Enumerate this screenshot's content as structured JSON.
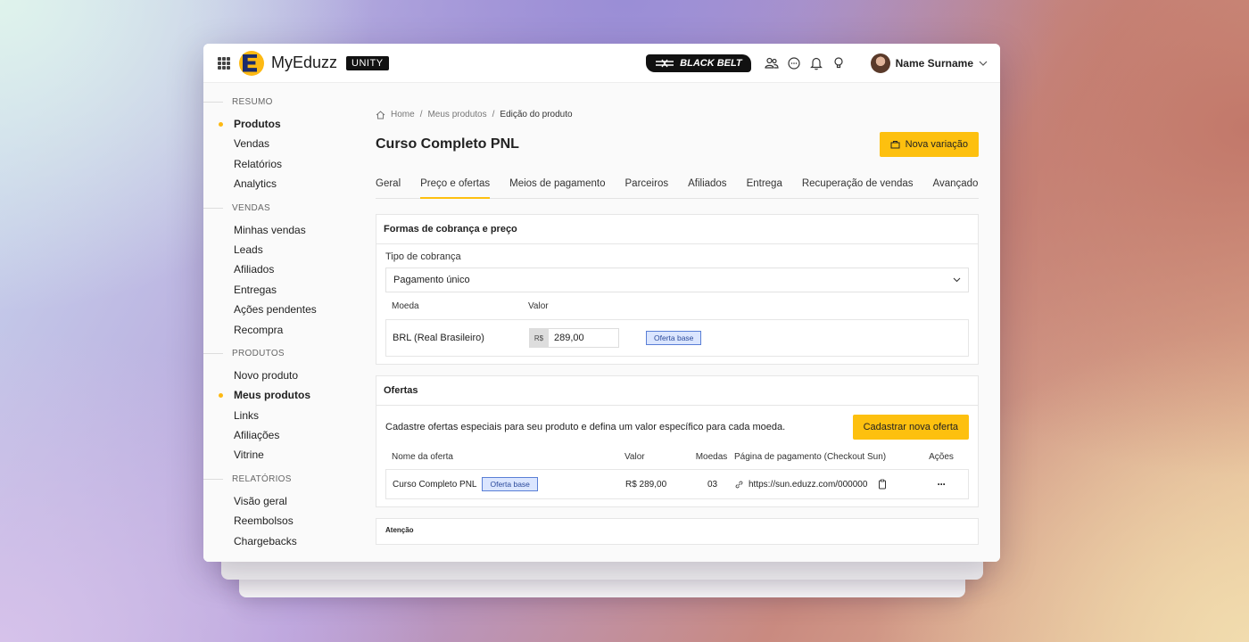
{
  "app": {
    "brand": "MyEduzz",
    "badge": "UNITY",
    "blackbelt": "BLACK BELT",
    "user_name": "Name Surname"
  },
  "icons": {
    "apps": "grid-icon",
    "users": "users-icon",
    "chat": "chat-icon",
    "notifications": "bell-icon",
    "tips": "lightbulb-icon"
  },
  "colors": {
    "accent": "#fdc00f",
    "badge_bg": "#dbe6ff",
    "badge_border": "#5a7fd6"
  },
  "sidebar": {
    "sections": [
      {
        "title": "RESUMO",
        "items": [
          {
            "label": "Produtos",
            "active": true
          },
          {
            "label": "Vendas"
          },
          {
            "label": "Relatórios"
          },
          {
            "label": "Analytics"
          }
        ]
      },
      {
        "title": "VENDAS",
        "items": [
          {
            "label": "Minhas vendas"
          },
          {
            "label": "Leads"
          },
          {
            "label": "Afiliados"
          },
          {
            "label": "Entregas"
          },
          {
            "label": "Ações pendentes"
          },
          {
            "label": "Recompra"
          }
        ]
      },
      {
        "title": "PRODUTOS",
        "items": [
          {
            "label": "Novo produto"
          },
          {
            "label": "Meus produtos",
            "active": true
          },
          {
            "label": "Links"
          },
          {
            "label": "Afiliações"
          },
          {
            "label": "Vitrine"
          }
        ]
      },
      {
        "title": "RELATÓRIOS",
        "items": [
          {
            "label": "Visão geral"
          },
          {
            "label": "Reembolsos"
          },
          {
            "label": "Chargebacks"
          }
        ]
      }
    ]
  },
  "breadcrumb": {
    "home": "Home",
    "sep": "/",
    "products": "Meus produtos",
    "current": "Edição do produto"
  },
  "page": {
    "title": "Curso Completo PNL",
    "new_variation": "Nova variação"
  },
  "tabs": [
    "Geral",
    "Preço e ofertas",
    "Meios de pagamento",
    "Parceiros",
    "Afiliados",
    "Entrega",
    "Recuperação de vendas",
    "Avançado"
  ],
  "active_tab": 1,
  "pricing": {
    "title": "Formas de cobrança e preço",
    "billing_label": "Tipo de cobrança",
    "billing_value": "Pagamento único",
    "col_currency": "Moeda",
    "col_value": "Valor",
    "currency": "BRL (Real Brasileiro)",
    "currency_prefix": "R$",
    "price": "289,00",
    "base_badge": "Oferta base"
  },
  "offers": {
    "title": "Ofertas",
    "description": "Cadastre ofertas especiais para seu produto e defina um valor específico para cada moeda.",
    "new_offer_button": "Cadastrar nova oferta",
    "headers": {
      "name": "Nome da oferta",
      "value": "Valor",
      "currencies": "Moedas",
      "page": "Página de pagamento (Checkout Sun)",
      "actions": "Ações"
    },
    "rows": [
      {
        "name": "Curso Completo PNL",
        "badge": "Oferta base",
        "value": "R$ 289,00",
        "currencies": "03",
        "url": "https://sun.eduzz.com/000000",
        "actions": "···"
      }
    ]
  },
  "attention": {
    "title": "Atenção"
  }
}
